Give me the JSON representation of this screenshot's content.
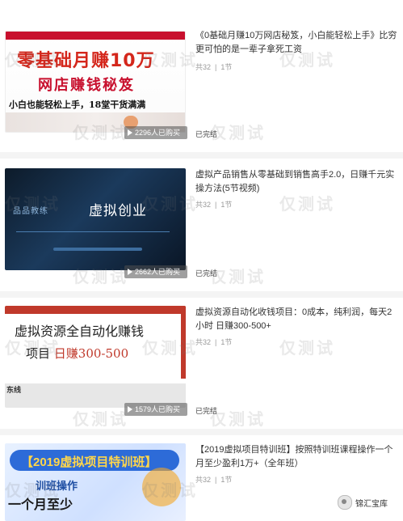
{
  "courses": [
    {
      "title": "《0基础月赚10万网店秘笈，小白能轻松上手》比穷更可怕的是一辈子拿死工资",
      "lessons": "共32",
      "lesson_sep": "|",
      "lesson_unit": "1节",
      "buyers": "2296人已购买",
      "status": "已完结",
      "thumb_lines": [
        "零基础月赚10万",
        "网店赚钱秘笈",
        "小白也能轻松上手，18堂干货满满"
      ]
    },
    {
      "title": "虚拟产品销售从零基础到销售高手2.0，日赚千元实操方法(5节视频)",
      "lessons": "共32",
      "lesson_sep": "|",
      "lesson_unit": "1节",
      "buyers": "2662人已购买",
      "status": "已完结",
      "thumb_lines": [
        "品品教练",
        "虚拟创业"
      ]
    },
    {
      "title": "虚拟资源自动化收钱项目：0成本，纯利润，每天2小时 日赚300-500+",
      "lessons": "共32",
      "lesson_sep": "|",
      "lesson_unit": "1节",
      "buyers": "1579人已购买",
      "status": "已完结",
      "thumb_lines": [
        "虚拟资源全自动化赚钱",
        "项目",
        "日赚300-500",
        "东线"
      ]
    },
    {
      "title": "【2019虚拟项目特训班】按照特训班课程操作一个月至少盈利1万+（全年班）",
      "lessons": "共32",
      "lesson_sep": "|",
      "lesson_unit": "1节",
      "thumb_lines": [
        "【2019虚拟项目特训班】",
        "训班操作",
        "一个月至少"
      ]
    }
  ],
  "watermark": "仅测试",
  "brand": "锦汇宝库"
}
